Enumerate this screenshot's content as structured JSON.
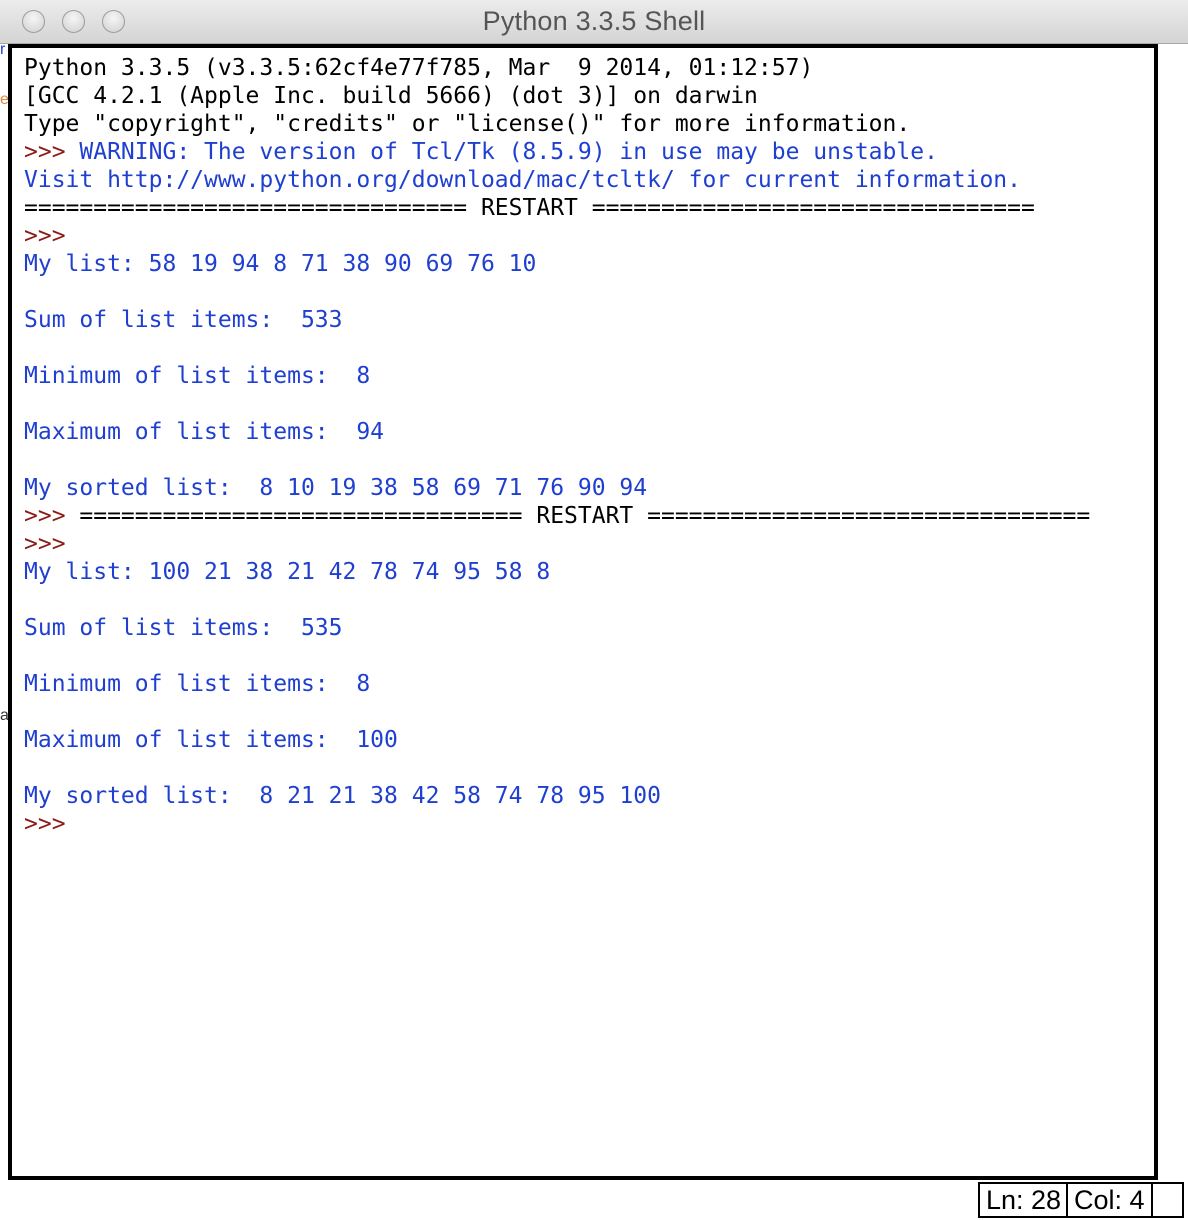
{
  "window": {
    "title": "Python 3.3.5 Shell"
  },
  "colors": {
    "stdout": "#000000",
    "output_blue": "#1f3fd0",
    "prompt_red": "#8a1b14"
  },
  "shell": {
    "lines": [
      {
        "segments": [
          {
            "text": "Python 3.3.5 (v3.3.5:62cf4e77f785, Mar  9 2014, 01:12:57) ",
            "style": "k"
          }
        ]
      },
      {
        "segments": [
          {
            "text": "[GCC 4.2.1 (Apple Inc. build 5666) (dot 3)] on darwin",
            "style": "k"
          }
        ]
      },
      {
        "segments": [
          {
            "text": "Type \"copyright\", \"credits\" or \"license()\" for more information.",
            "style": "k"
          }
        ]
      },
      {
        "segments": [
          {
            "text": ">>> ",
            "style": "p"
          },
          {
            "text": "WARNING: The version of Tcl/Tk (8.5.9) in use may be unstable.",
            "style": "b"
          }
        ]
      },
      {
        "segments": [
          {
            "text": "Visit http://www.python.org/download/mac/tcltk/ for current information.",
            "style": "b"
          }
        ]
      },
      {
        "segments": [
          {
            "text": "================================ RESTART ================================",
            "style": "k"
          }
        ]
      },
      {
        "segments": [
          {
            "text": ">>> ",
            "style": "p"
          }
        ]
      },
      {
        "segments": [
          {
            "text": "My list: 58 19 94 8 71 38 90 69 76 10",
            "style": "b"
          }
        ]
      },
      {
        "segments": [
          {
            "text": "",
            "style": "b"
          }
        ]
      },
      {
        "segments": [
          {
            "text": "Sum of list items:  533",
            "style": "b"
          }
        ]
      },
      {
        "segments": [
          {
            "text": "",
            "style": "b"
          }
        ]
      },
      {
        "segments": [
          {
            "text": "Minimum of list items:  8",
            "style": "b"
          }
        ]
      },
      {
        "segments": [
          {
            "text": "",
            "style": "b"
          }
        ]
      },
      {
        "segments": [
          {
            "text": "Maximum of list items:  94",
            "style": "b"
          }
        ]
      },
      {
        "segments": [
          {
            "text": "",
            "style": "b"
          }
        ]
      },
      {
        "segments": [
          {
            "text": "My sorted list:  8 10 19 38 58 69 71 76 90 94",
            "style": "b"
          }
        ]
      },
      {
        "segments": [
          {
            "text": ">>> ",
            "style": "p"
          },
          {
            "text": "================================ RESTART ================================",
            "style": "k"
          }
        ]
      },
      {
        "segments": [
          {
            "text": ">>> ",
            "style": "p"
          }
        ]
      },
      {
        "segments": [
          {
            "text": "My list: 100 21 38 21 42 78 74 95 58 8",
            "style": "b"
          }
        ]
      },
      {
        "segments": [
          {
            "text": "",
            "style": "b"
          }
        ]
      },
      {
        "segments": [
          {
            "text": "Sum of list items:  535",
            "style": "b"
          }
        ]
      },
      {
        "segments": [
          {
            "text": "",
            "style": "b"
          }
        ]
      },
      {
        "segments": [
          {
            "text": "Minimum of list items:  8",
            "style": "b"
          }
        ]
      },
      {
        "segments": [
          {
            "text": "",
            "style": "b"
          }
        ]
      },
      {
        "segments": [
          {
            "text": "Maximum of list items:  100",
            "style": "b"
          }
        ]
      },
      {
        "segments": [
          {
            "text": "",
            "style": "b"
          }
        ]
      },
      {
        "segments": [
          {
            "text": "My sorted list:  8 21 21 38 42 58 74 78 95 100",
            "style": "b"
          }
        ]
      },
      {
        "segments": [
          {
            "text": ">>> ",
            "style": "p"
          }
        ]
      }
    ]
  },
  "statusbar": {
    "line": "Ln: 28",
    "col": "Col: 4"
  }
}
